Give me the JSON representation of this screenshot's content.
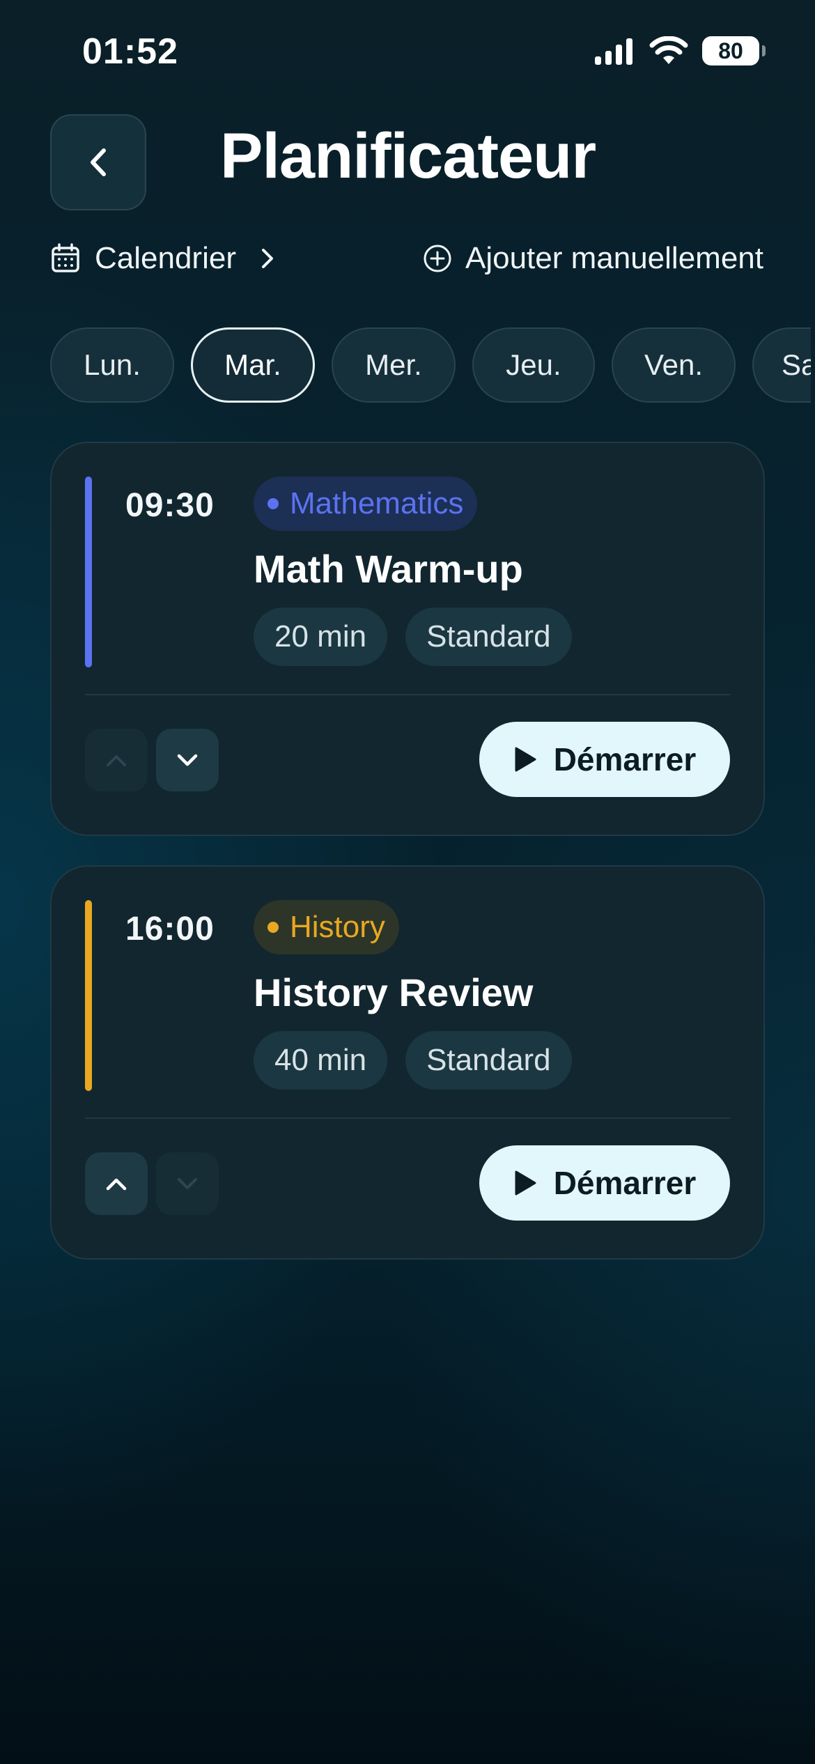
{
  "status_bar": {
    "time": "01:52",
    "battery": "80",
    "icons": [
      "signal-icon",
      "wifi-icon",
      "battery-icon"
    ]
  },
  "header": {
    "title": "Planificateur",
    "back_icon": "chevron-left-icon"
  },
  "actions": {
    "calendar_label": "Calendrier",
    "add_label": "Ajouter manuellement"
  },
  "days": [
    {
      "label": "Lun.",
      "active": false
    },
    {
      "label": "Mar.",
      "active": true
    },
    {
      "label": "Mer.",
      "active": false
    },
    {
      "label": "Jeu.",
      "active": false
    },
    {
      "label": "Ven.",
      "active": false
    },
    {
      "label": "Sa",
      "active": false
    }
  ],
  "sessions": [
    {
      "time": "09:30",
      "subject": "Mathematics",
      "subject_color": "#5b73f0",
      "title": "Math Warm-up",
      "duration": "20 min",
      "mode": "Standard",
      "can_move_up": false,
      "can_move_down": true,
      "start_label": "Démarrer"
    },
    {
      "time": "16:00",
      "subject": "History",
      "subject_color": "#e9a822",
      "title": "History Review",
      "duration": "40 min",
      "mode": "Standard",
      "can_move_up": true,
      "can_move_down": false,
      "start_label": "Démarrer"
    }
  ],
  "colors": {
    "background": "#06222f",
    "card": "#12262f",
    "start_button": "#e1f7fb",
    "math_accent": "#5b73f0",
    "history_accent": "#e9a822"
  }
}
